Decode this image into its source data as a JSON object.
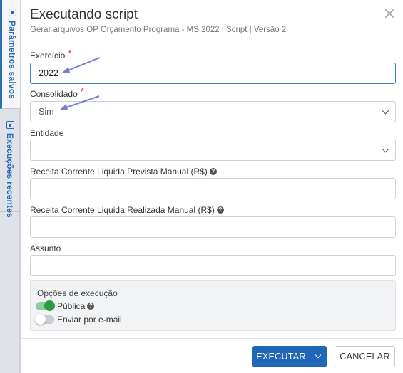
{
  "side_tabs": [
    {
      "label": "Parâmetros salvos",
      "active": true
    },
    {
      "label": "Execuções recentes",
      "active": false
    }
  ],
  "dialog": {
    "title": "Executando script",
    "subtitle": "Gerar arquivos OP Orçamento Programa - MS 2022 | Script | Versão 2"
  },
  "form": {
    "exercicio": {
      "label": "Exercício",
      "required": true,
      "value": "2022"
    },
    "consolidado": {
      "label": "Consolidado",
      "required": true,
      "value": "Sim"
    },
    "entidade": {
      "label": "Entidade",
      "value": ""
    },
    "receita_prevista": {
      "label": "Receita Corrente Liquida Prevista Manual (R$)",
      "value": ""
    },
    "receita_realizada": {
      "label": "Receita Corrente Liquida Realizada Manual (R$)",
      "value": ""
    },
    "assunto": {
      "label": "Assunto",
      "value": ""
    }
  },
  "execution_options": {
    "title": "Opções de execução",
    "publica": {
      "label": "Pública",
      "on": true
    },
    "email": {
      "label": "Enviar por e-mail",
      "on": false
    }
  },
  "buttons": {
    "execute": "EXECUTAR",
    "cancel": "CANCELAR"
  },
  "colors": {
    "primary": "#2167b7",
    "toggle_on": "#2e9a45",
    "required": "#d9262b",
    "annotation_arrow": "#7b7fcf"
  },
  "icons": {
    "help": "?"
  }
}
